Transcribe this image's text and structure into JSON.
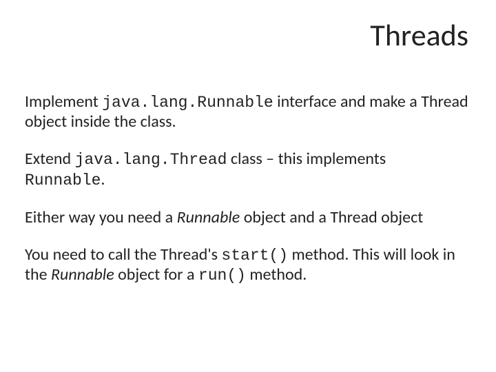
{
  "title": "Threads",
  "p1": {
    "t1": "Implement ",
    "code": "java.lang.Runnable",
    "t2": " interface and make a Thread object inside the class."
  },
  "p2": {
    "t1": "Extend ",
    "code1": "java.lang.Thread",
    "t2": " class – this implements ",
    "code2": "Runnable",
    "t3": "."
  },
  "p3": {
    "t1": "Either way you need a ",
    "ital": "Runnable",
    "t2": " object and a Thread object"
  },
  "p4": {
    "t1": "You need to call the Thread's ",
    "code1": "start()",
    "t2": " method. This will look in the ",
    "ital": "Runnable",
    "t3": " object for a ",
    "code2": "run()",
    "t4": " method."
  }
}
